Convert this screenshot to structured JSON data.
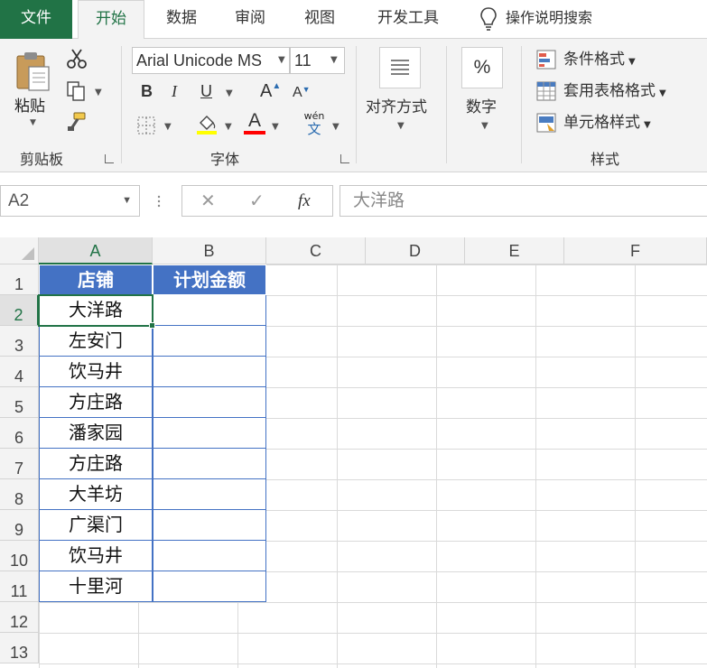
{
  "tabs": {
    "file": "文件",
    "home": "开始",
    "data": "数据",
    "review": "审阅",
    "view": "视图",
    "developer": "开发工具",
    "tell_me": "操作说明搜索"
  },
  "ribbon": {
    "clipboard": {
      "paste_label": "粘贴",
      "group_label": "剪贴板"
    },
    "font": {
      "font_name": "Arial Unicode MS",
      "font_size": "11",
      "bold": "B",
      "italic": "I",
      "underline": "U",
      "grow": "A",
      "shrink": "A",
      "font_color_letter": "A",
      "phonetic_top": "wén",
      "phonetic_bottom": "文",
      "group_label": "字体",
      "fill_color": "#ffff00",
      "font_color": "#ff0000"
    },
    "alignment": {
      "label": "对齐方式"
    },
    "number": {
      "label": "数字",
      "icon_text": "%"
    },
    "styles": {
      "conditional": "条件格式",
      "table_format": "套用表格格式",
      "cell_styles": "单元格样式",
      "group_label": "样式"
    }
  },
  "formula_bar": {
    "name_box": "A2",
    "cancel": "✕",
    "enter": "✓",
    "fx": "fx",
    "content": "大洋路"
  },
  "sheet": {
    "columns": [
      "A",
      "B",
      "C",
      "D",
      "E",
      "F"
    ],
    "rows": [
      "1",
      "2",
      "3",
      "4",
      "5",
      "6",
      "7",
      "8",
      "9",
      "10",
      "11",
      "12",
      "13"
    ],
    "selected_cell": "A2",
    "header_color": "#4472c4",
    "table": {
      "headers": [
        "店铺",
        "计划金额"
      ],
      "stores": [
        "大洋路",
        "左安门",
        "饮马井",
        "方庄路",
        "潘家园",
        "方庄路",
        "大羊坊",
        "广渠门",
        "饮马井",
        "十里河"
      ],
      "amounts": [
        "",
        "",
        "",
        "",
        "",
        "",
        "",
        "",
        "",
        ""
      ]
    }
  }
}
